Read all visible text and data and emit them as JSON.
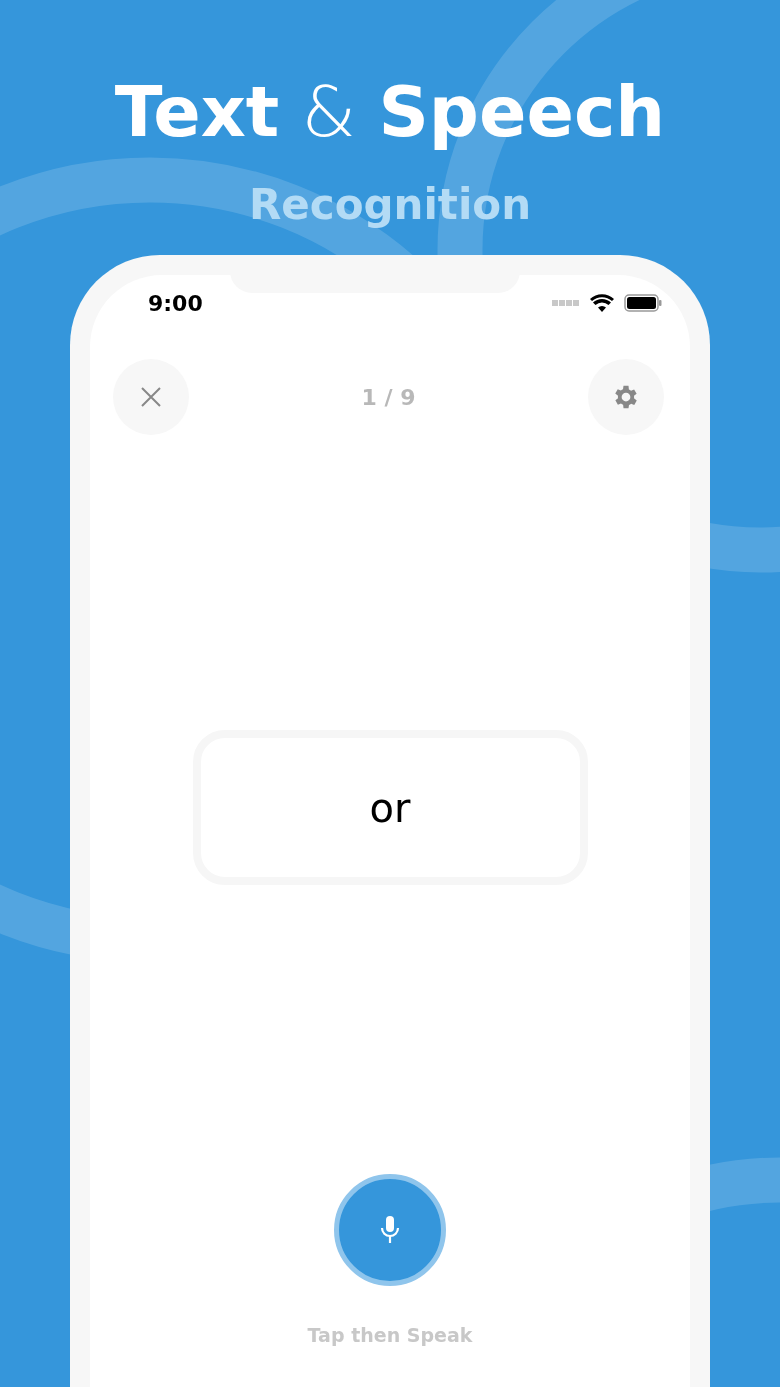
{
  "headline": {
    "title": "**Text** & **Speech**",
    "subtitle": "Recognition"
  },
  "status_bar": {
    "time": "9:00"
  },
  "toolbar": {
    "progress": "1 / 9"
  },
  "card": {
    "word": "or"
  },
  "mic": {
    "label": "Tap then Speak"
  }
}
